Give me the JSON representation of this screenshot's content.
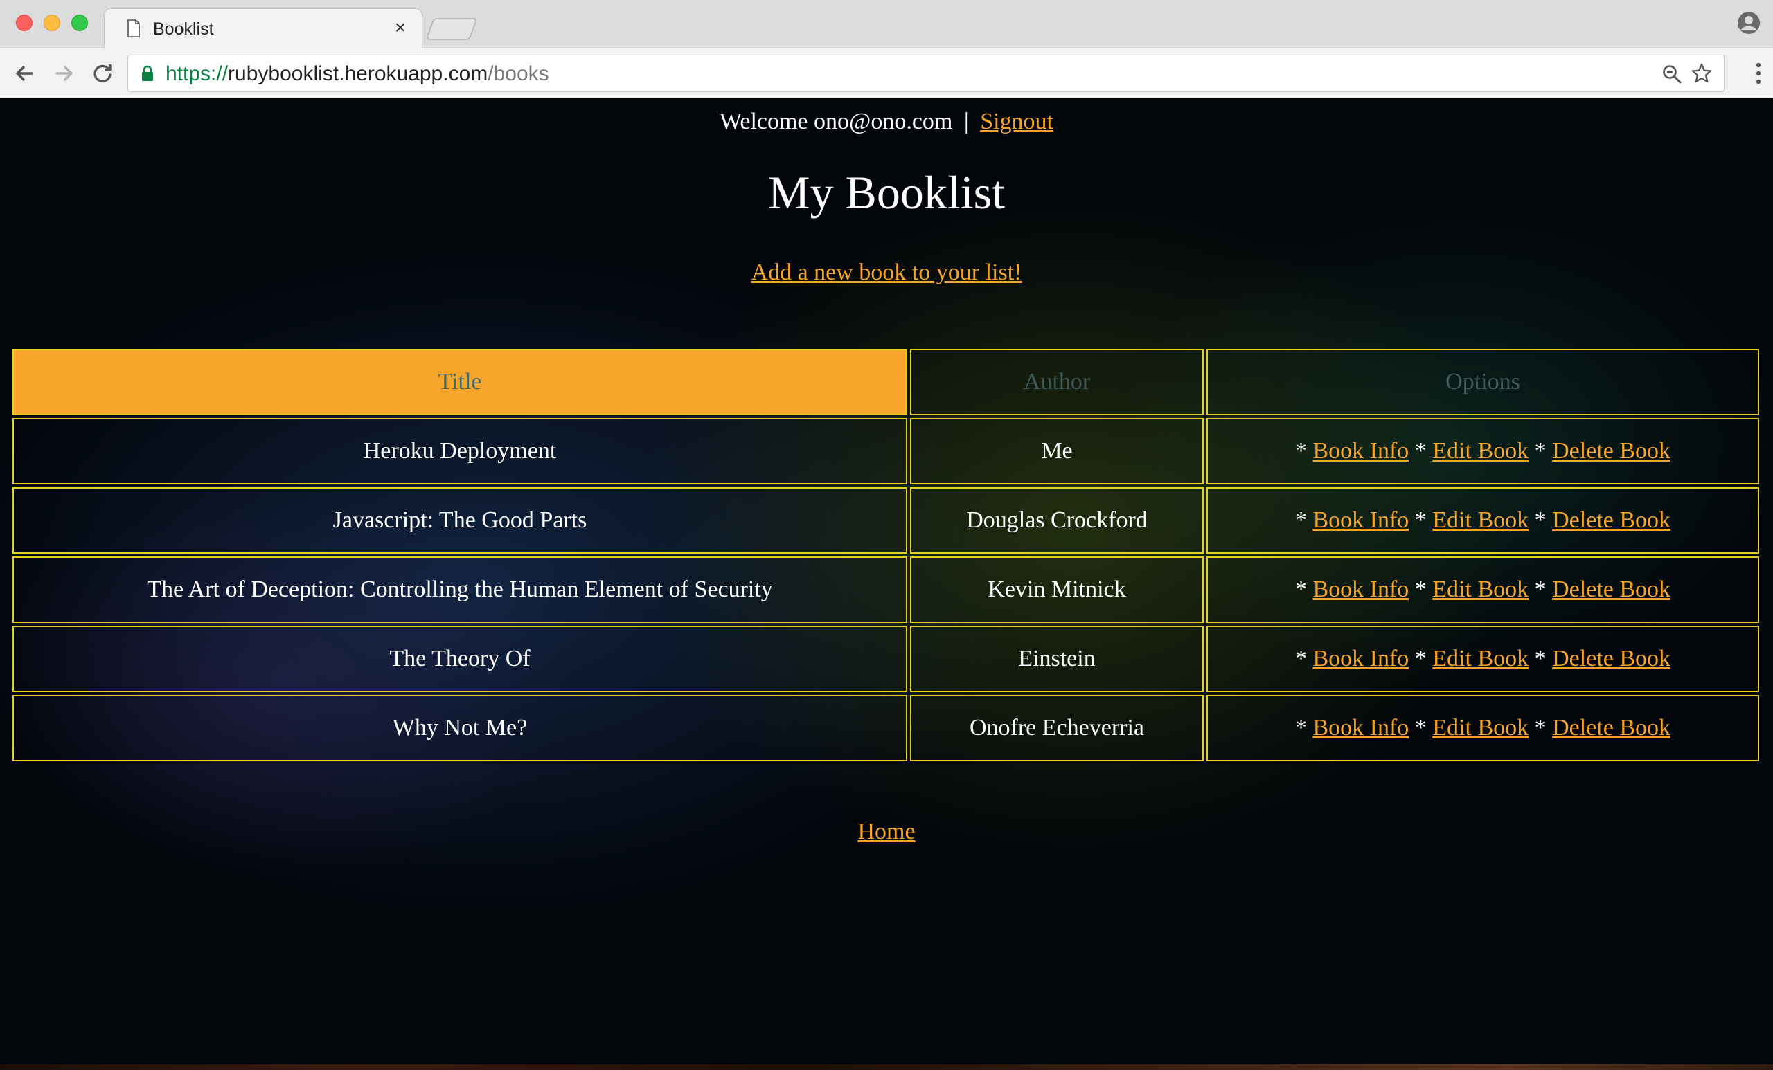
{
  "browser": {
    "tab_title": "Booklist",
    "tab_close": "×",
    "url_scheme": "https://",
    "url_host": "rubybooklist.herokuapp.com",
    "url_path": "/books"
  },
  "header": {
    "welcome_text": "Welcome ono@ono.com",
    "separator": "|",
    "signout_label": "Signout"
  },
  "main": {
    "title": "My Booklist",
    "add_book_label": "Add a new book to your list!"
  },
  "table": {
    "headers": [
      "Title",
      "Author",
      "Options"
    ],
    "rows": [
      {
        "title": "Heroku Deployment",
        "author": "Me"
      },
      {
        "title": "Javascript: The Good Parts",
        "author": "Douglas Crockford"
      },
      {
        "title": "The Art of Deception: Controlling the Human Element of Security",
        "author": "Kevin Mitnick"
      },
      {
        "title": "The Theory Of",
        "author": "Einstein"
      },
      {
        "title": "Why Not Me?",
        "author": "Onofre Echeverria"
      }
    ],
    "options": {
      "bullet": "*",
      "book_info": "Book Info",
      "edit_book": "Edit Book",
      "delete_book": "Delete Book"
    }
  },
  "footer": {
    "home_label": "Home"
  },
  "colors": {
    "accent": "#f7a52a",
    "table_border": "#e6d21c",
    "background": "#02050a"
  },
  "icons": [
    "page-icon",
    "close-icon",
    "profile-icon",
    "back-arrow-icon",
    "forward-arrow-icon",
    "reload-icon",
    "lock-icon",
    "zoom-icon",
    "star-icon",
    "menu-icon"
  ]
}
